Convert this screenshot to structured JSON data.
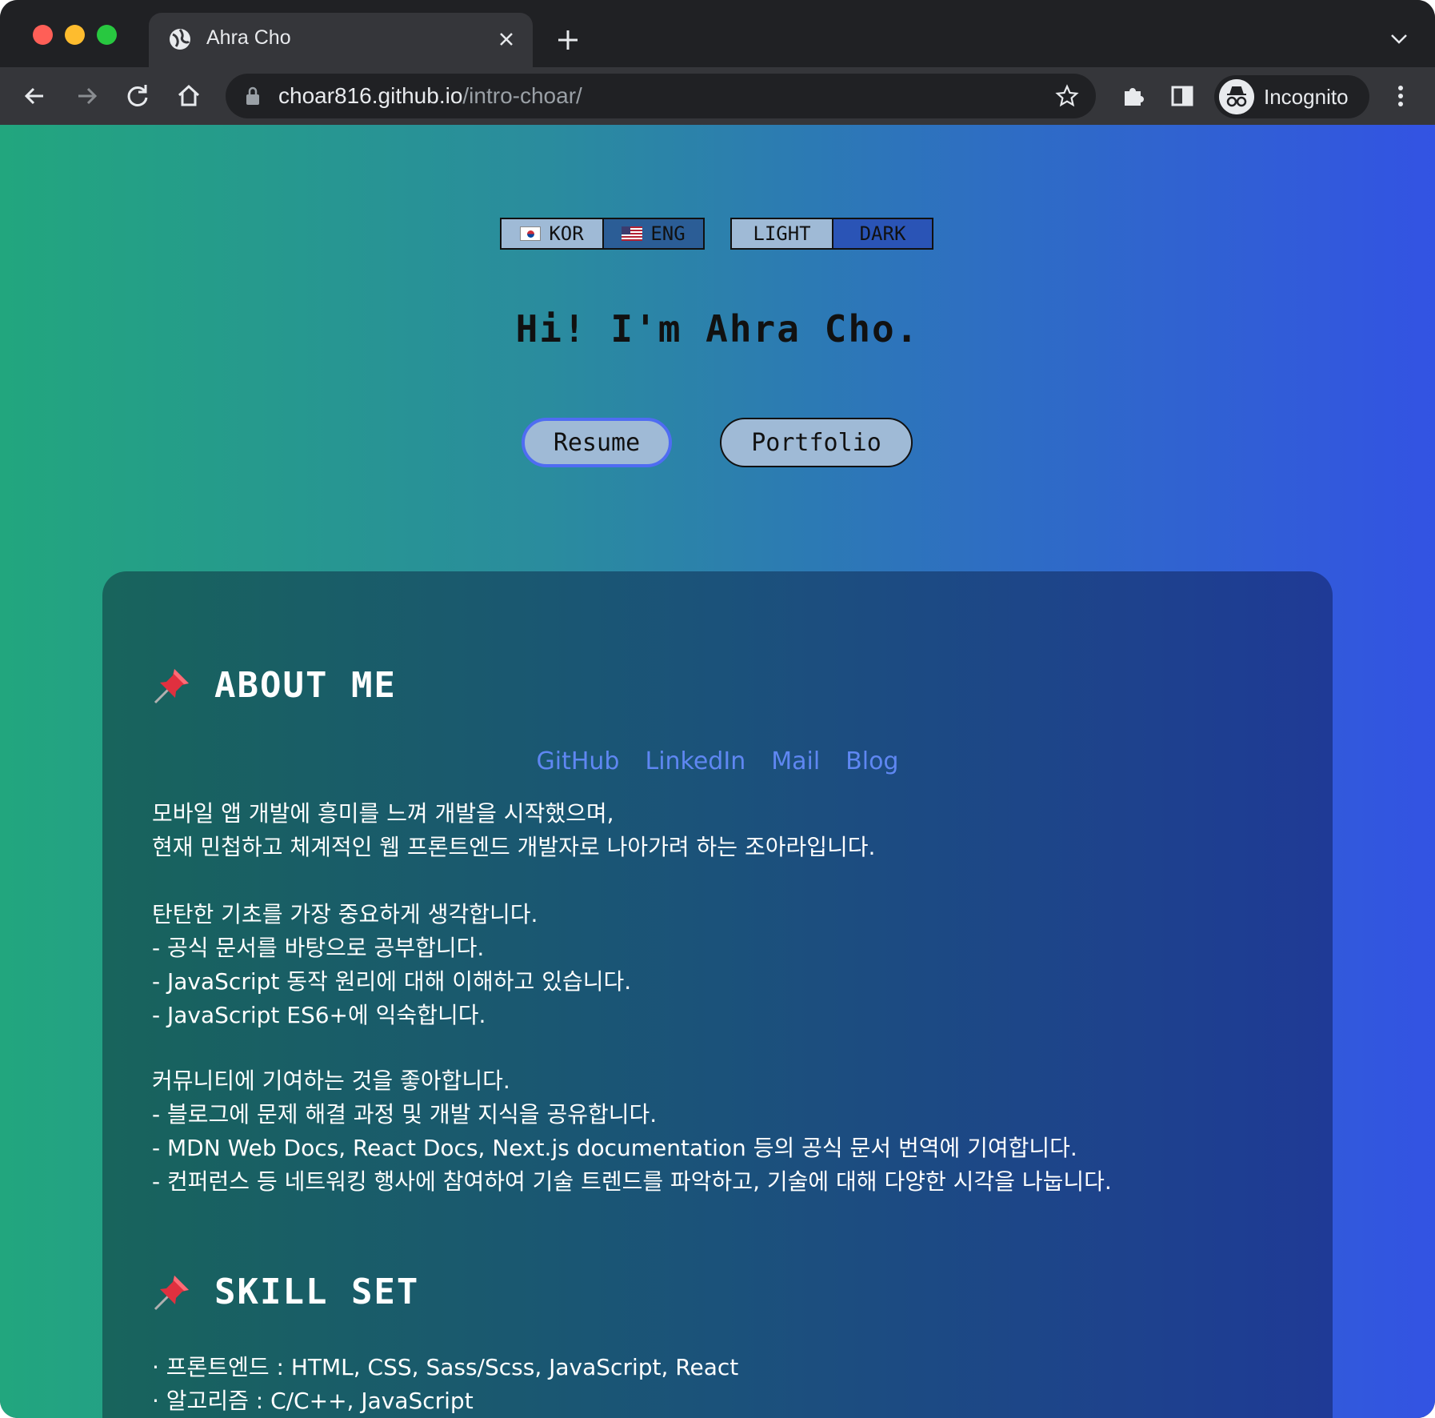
{
  "browser": {
    "tab_title": "Ahra Cho",
    "url_host": "choar816.github.io",
    "url_path": "/intro-choar/",
    "incognito_label": "Incognito"
  },
  "toggles": {
    "lang": [
      {
        "label": "KOR",
        "icon": "flag-kr-icon"
      },
      {
        "label": "ENG",
        "icon": "flag-us-icon"
      }
    ],
    "theme": [
      {
        "label": "LIGHT"
      },
      {
        "label": "DARK"
      }
    ]
  },
  "hero": {
    "title": "Hi! I'm Ahra Cho.",
    "buttons": {
      "resume": "Resume",
      "portfolio": "Portfolio"
    }
  },
  "about": {
    "heading": "ABOUT ME",
    "links": [
      "GitHub",
      "LinkedIn",
      "Mail",
      "Blog"
    ],
    "intro": [
      "모바일 앱 개발에 흥미를 느껴 개발을 시작했으며,",
      "현재 민첩하고 체계적인 웹 프론트엔드 개발자로 나아가려 하는 조아라입니다."
    ],
    "basics": [
      "탄탄한 기초를 가장 중요하게 생각합니다.",
      "- 공식 문서를 바탕으로 공부합니다.",
      "- JavaScript 동작 원리에 대해 이해하고 있습니다.",
      "- JavaScript ES6+에 익숙합니다."
    ],
    "community": [
      "커뮤니티에 기여하는 것을 좋아합니다.",
      "- 블로그에 문제 해결 과정 및 개발 지식을 공유합니다.",
      "- MDN Web Docs, React Docs, Next.js documentation 등의 공식 문서 번역에 기여합니다.",
      "- 컨퍼런스 등 네트워킹 행사에 참여하여 기술 트렌드를 파악하고, 기술에 대해 다양한 시각을 나눕니다."
    ]
  },
  "skills": {
    "heading": "SKILL SET",
    "items": [
      "· 프론트엔드 : HTML, CSS, Sass/Scss, JavaScript, React",
      "· 알고리즘 : C/C++, JavaScript"
    ]
  },
  "colors": {
    "link": "#5f87f2",
    "accent_border": "#4f6cf2",
    "pill_bg": "#9fbad6"
  }
}
